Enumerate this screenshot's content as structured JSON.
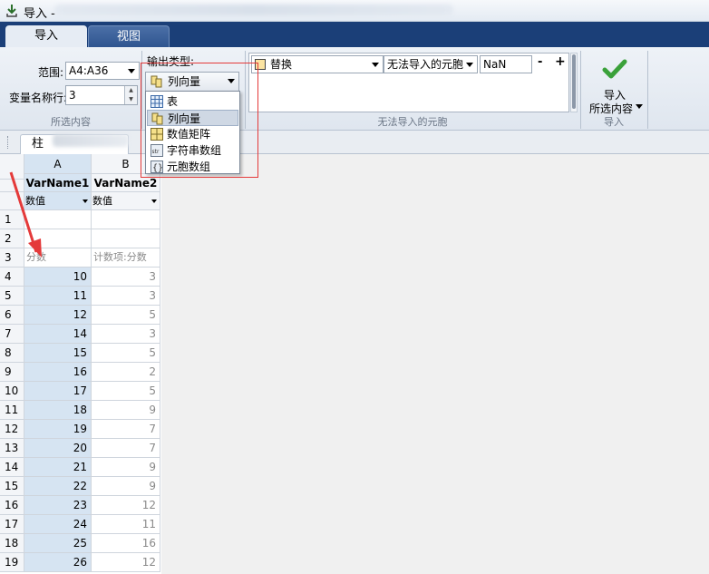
{
  "window": {
    "title": "导入 -"
  },
  "tabs": [
    {
      "label": "导入",
      "active": true
    },
    {
      "label": "视图",
      "active": false
    }
  ],
  "ribbon": {
    "selection": {
      "range_label": "范围:",
      "range_value": "A4:A36",
      "varnames_label": "变量名称行:",
      "varnames_value": "3",
      "caption": "所选内容"
    },
    "output": {
      "label": "输出类型:",
      "selected": "列向量",
      "options": [
        "表",
        "列向量",
        "数值矩阵",
        "字符串数组",
        "元胞数组"
      ]
    },
    "unimportable": {
      "action": "替换",
      "target": "无法导入的元胞",
      "value": "NaN",
      "minus": "-",
      "plus": "+",
      "caption": "无法导入的元胞"
    },
    "import": {
      "line1": "导入",
      "line2": "所选内容",
      "caption": "导入"
    }
  },
  "doc_tab": {
    "label": "柱"
  },
  "grid": {
    "columns": [
      {
        "letter": "A",
        "varname": "VarName1",
        "type": "数值"
      },
      {
        "letter": "B",
        "varname": "VarName2",
        "type": "数值"
      }
    ],
    "rows": [
      {
        "n": "1",
        "a": "",
        "b": ""
      },
      {
        "n": "2",
        "a": "",
        "b": ""
      },
      {
        "n": "3",
        "a": "分数",
        "b": "计数项:分数"
      },
      {
        "n": "4",
        "a": "10",
        "b": "3"
      },
      {
        "n": "5",
        "a": "11",
        "b": "3"
      },
      {
        "n": "6",
        "a": "12",
        "b": "5"
      },
      {
        "n": "7",
        "a": "14",
        "b": "3"
      },
      {
        "n": "8",
        "a": "15",
        "b": "5"
      },
      {
        "n": "9",
        "a": "16",
        "b": "2"
      },
      {
        "n": "10",
        "a": "17",
        "b": "5"
      },
      {
        "n": "11",
        "a": "18",
        "b": "9"
      },
      {
        "n": "12",
        "a": "19",
        "b": "7"
      },
      {
        "n": "13",
        "a": "20",
        "b": "7"
      },
      {
        "n": "14",
        "a": "21",
        "b": "9"
      },
      {
        "n": "15",
        "a": "22",
        "b": "9"
      },
      {
        "n": "16",
        "a": "23",
        "b": "12"
      },
      {
        "n": "17",
        "a": "24",
        "b": "11"
      },
      {
        "n": "18",
        "a": "25",
        "b": "16"
      },
      {
        "n": "19",
        "a": "26",
        "b": "12"
      }
    ]
  },
  "colors": {
    "tabstrip": "#1b3f78",
    "selected_cell": "#d6e4f2",
    "annotation": "#e43a3a",
    "check": "#3aa13a"
  }
}
